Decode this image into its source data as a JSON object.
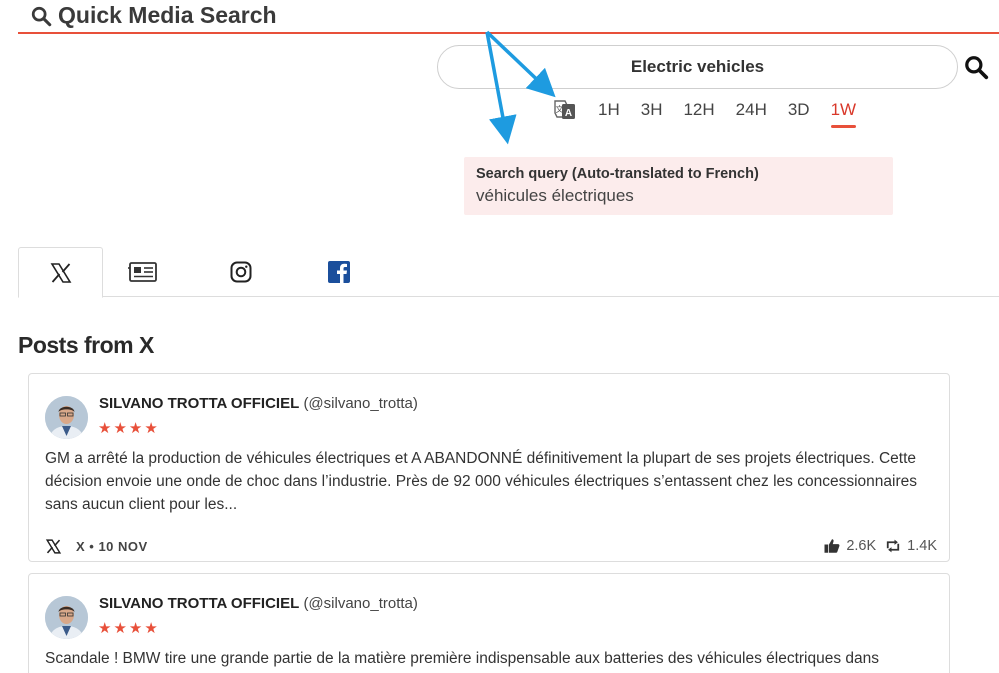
{
  "app": {
    "title": "Quick Media Search"
  },
  "search": {
    "query": "Electric vehicles",
    "placeholder": ""
  },
  "time_filters": [
    {
      "label": "1H",
      "active": false
    },
    {
      "label": "3H",
      "active": false
    },
    {
      "label": "12H",
      "active": false
    },
    {
      "label": "24H",
      "active": false
    },
    {
      "label": "3D",
      "active": false
    },
    {
      "label": "1W",
      "active": true
    }
  ],
  "translation": {
    "label": "Search query (Auto-translated to French)",
    "value": "véhicules électriques"
  },
  "tabs": [
    {
      "icon": "x-logo-icon",
      "active": true
    },
    {
      "icon": "newspaper-icon",
      "active": false
    },
    {
      "icon": "instagram-icon",
      "active": false
    },
    {
      "icon": "facebook-icon",
      "active": false
    }
  ],
  "section": {
    "title": "Posts from X"
  },
  "posts": [
    {
      "author": "SILVANO TROTTA OFFICIEL",
      "handle": "(@silvano_trotta)",
      "rating": "★★★★",
      "text": "GM a arrêté la production de véhicules électriques et A ABANDONNÉ définitivement la plupart de ses projets électriques. Cette décision envoie une onde de choc dans l’industrie. Près de 92 000 véhicules électriques s’entassent chez les concessionnaires sans aucun client pour les...",
      "source": "X • 10 NOV",
      "likes": "2.6K",
      "reposts": "1.4K"
    },
    {
      "author": "SILVANO TROTTA OFFICIEL",
      "handle": "(@silvano_trotta)",
      "rating": "★★★★",
      "text": "Scandale ! BMW tire une grande partie de la matière première indispensable aux batteries des véhicules électriques dans",
      "source": "",
      "likes": "",
      "reposts": ""
    }
  ],
  "colors": {
    "accent": "#e8503a",
    "arrow": "#1e9be0",
    "translation_bg": "#fcecec"
  }
}
